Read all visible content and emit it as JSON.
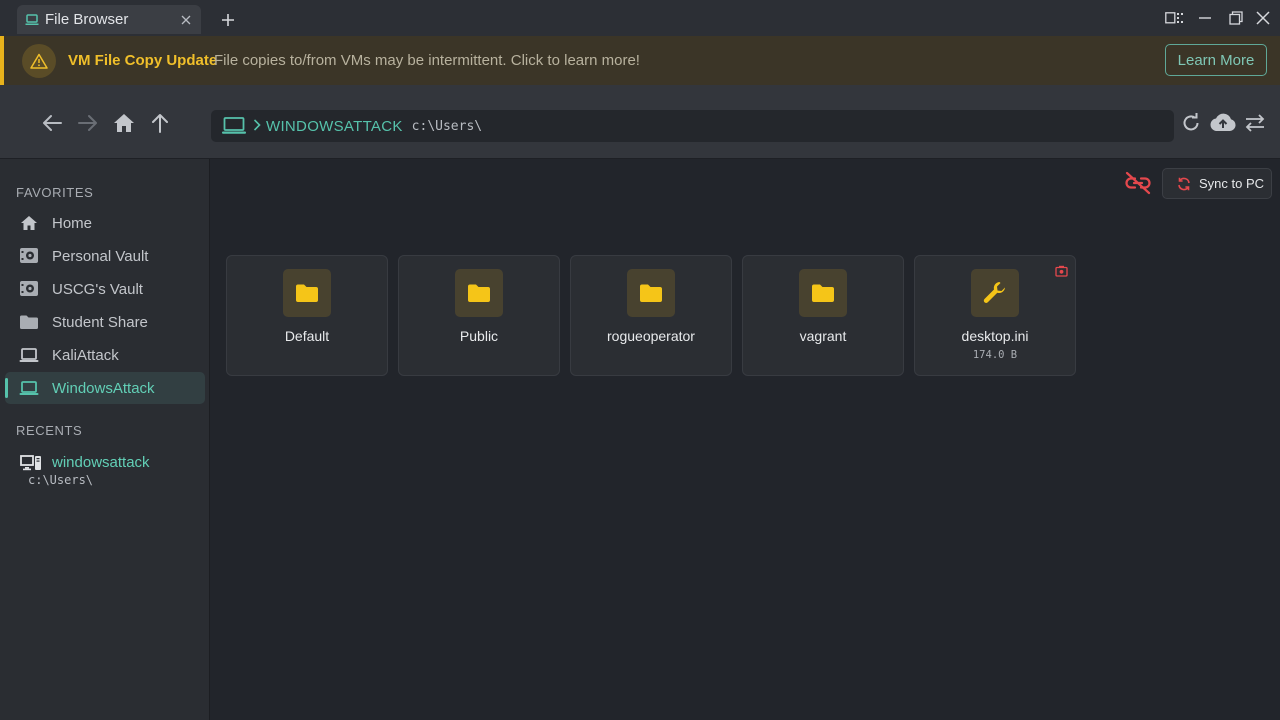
{
  "window": {
    "tab_title": "File Browser",
    "tab_icon": "laptop-icon",
    "controls": [
      "snap-layout-icon",
      "minimize-icon",
      "restore-icon",
      "close-icon"
    ]
  },
  "banner": {
    "title": "VM File Copy Update",
    "message": "File copies to/from VMs may be intermittent. Click to learn more!",
    "button": "Learn More",
    "accent": "#e8b31c"
  },
  "nav": {
    "path_machine": "WINDOWSATTACK",
    "path_dir": "c:\\Users\\"
  },
  "sidebar": {
    "favorites_title": "FAVORITES",
    "items": [
      {
        "label": "Home",
        "icon": "home-icon"
      },
      {
        "label": "Personal Vault",
        "icon": "vault-icon"
      },
      {
        "label": "USCG's Vault",
        "icon": "vault-icon"
      },
      {
        "label": "Student Share",
        "icon": "folder-icon"
      },
      {
        "label": "KaliAttack",
        "icon": "laptop-icon"
      },
      {
        "label": "WindowsAttack",
        "icon": "laptop-icon",
        "active": true
      }
    ],
    "recents_title": "RECENTS",
    "recent": {
      "name": "windowsattack",
      "path": "c:\\Users\\"
    }
  },
  "content": {
    "sync_label": "Sync to PC",
    "files": [
      {
        "name": "Default",
        "type": "folder"
      },
      {
        "name": "Public",
        "type": "folder"
      },
      {
        "name": "rogueoperator",
        "type": "folder"
      },
      {
        "name": "vagrant",
        "type": "folder"
      },
      {
        "name": "desktop.ini",
        "type": "file",
        "size": "174.0 B"
      }
    ]
  },
  "colors": {
    "accent": "#56c2ab",
    "folder": "#f5c518",
    "danger": "#e5484d"
  }
}
